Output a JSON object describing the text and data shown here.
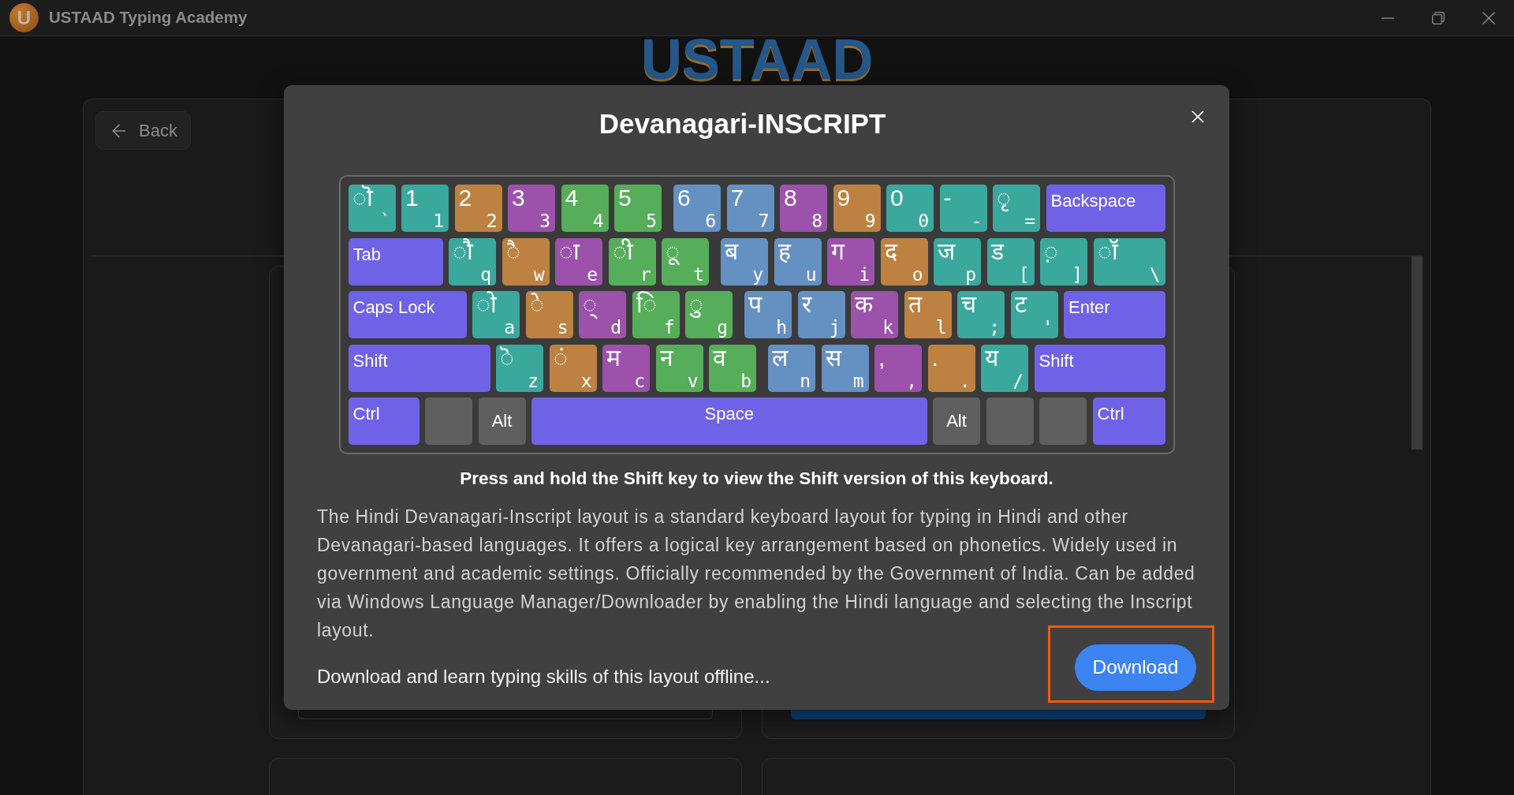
{
  "window": {
    "logo_letter": "U",
    "title": "USTAAD Typing Academy"
  },
  "brand_logo": "USTAAD",
  "back_button": "Back",
  "dialog": {
    "title": "Devanagari-INSCRIPT",
    "keyboard": {
      "rows": [
        {
          "keys": [
            {
              "kind": "char",
              "glyph": "◌ॊ",
              "key": "`",
              "color": "#3aa89d"
            },
            {
              "kind": "char",
              "glyph": "1",
              "key": "1",
              "color": "#3aa89d"
            },
            {
              "kind": "char",
              "glyph": "2",
              "key": "2",
              "color": "#bd8142"
            },
            {
              "kind": "char",
              "glyph": "3",
              "key": "3",
              "color": "#9c51aa"
            },
            {
              "kind": "char",
              "glyph": "4",
              "key": "4",
              "color": "#56ad5a"
            },
            {
              "kind": "char",
              "glyph": "5",
              "key": "5",
              "color": "#56ad5a"
            },
            {
              "kind": "char",
              "glyph": "6",
              "key": "6",
              "color": "#6590c2"
            },
            {
              "kind": "char",
              "glyph": "7",
              "key": "7",
              "color": "#6590c2"
            },
            {
              "kind": "char",
              "glyph": "8",
              "key": "8",
              "color": "#9c51aa"
            },
            {
              "kind": "char",
              "glyph": "9",
              "key": "9",
              "color": "#bd8142"
            },
            {
              "kind": "char",
              "glyph": "0",
              "key": "0",
              "color": "#3aa89d"
            },
            {
              "kind": "char",
              "glyph": "-",
              "key": "-",
              "color": "#3aa89d"
            },
            {
              "kind": "char",
              "glyph": "◌ृ",
              "key": "=",
              "color": "#3aa89d"
            },
            {
              "kind": "modifier",
              "label": "Backspace",
              "color": "#7062e6"
            }
          ]
        },
        {
          "keys": [
            {
              "kind": "modifier",
              "label": "Tab",
              "color": "#7062e6"
            },
            {
              "kind": "char",
              "glyph": "◌ौ",
              "key": "q",
              "color": "#3aa89d"
            },
            {
              "kind": "char",
              "glyph": "◌ै",
              "key": "w",
              "color": "#bd8142"
            },
            {
              "kind": "char",
              "glyph": "◌ा",
              "key": "e",
              "color": "#9c51aa"
            },
            {
              "kind": "char",
              "glyph": "◌ी",
              "key": "r",
              "color": "#56ad5a"
            },
            {
              "kind": "char",
              "glyph": "◌ू",
              "key": "t",
              "color": "#56ad5a"
            },
            {
              "kind": "char",
              "glyph": "ब",
              "key": "y",
              "color": "#6590c2"
            },
            {
              "kind": "char",
              "glyph": "ह",
              "key": "u",
              "color": "#6590c2"
            },
            {
              "kind": "char",
              "glyph": "ग",
              "key": "i",
              "color": "#9c51aa"
            },
            {
              "kind": "char",
              "glyph": "द",
              "key": "o",
              "color": "#bd8142"
            },
            {
              "kind": "char",
              "glyph": "ज",
              "key": "p",
              "color": "#3aa89d"
            },
            {
              "kind": "char",
              "glyph": "ड",
              "key": "[",
              "color": "#3aa89d"
            },
            {
              "kind": "char",
              "glyph": "◌़",
              "key": "]",
              "color": "#3aa89d"
            },
            {
              "kind": "char",
              "glyph": "◌ॉ",
              "key": "\\",
              "color": "#3aa89d"
            }
          ]
        },
        {
          "keys": [
            {
              "kind": "modifier",
              "label": "Caps Lock",
              "color": "#7062e6"
            },
            {
              "kind": "char",
              "glyph": "◌ो",
              "key": "a",
              "color": "#3aa89d"
            },
            {
              "kind": "char",
              "glyph": "◌े",
              "key": "s",
              "color": "#bd8142"
            },
            {
              "kind": "char",
              "glyph": "◌्",
              "key": "d",
              "color": "#9c51aa"
            },
            {
              "kind": "char",
              "glyph": "◌ि",
              "key": "f",
              "color": "#56ad5a"
            },
            {
              "kind": "char",
              "glyph": "◌ु",
              "key": "g",
              "color": "#56ad5a"
            },
            {
              "kind": "char",
              "glyph": "प",
              "key": "h",
              "color": "#6590c2"
            },
            {
              "kind": "char",
              "glyph": "र",
              "key": "j",
              "color": "#6590c2"
            },
            {
              "kind": "char",
              "glyph": "क",
              "key": "k",
              "color": "#9c51aa"
            },
            {
              "kind": "char",
              "glyph": "त",
              "key": "l",
              "color": "#bd8142"
            },
            {
              "kind": "char",
              "glyph": "च",
              "key": ";",
              "color": "#3aa89d"
            },
            {
              "kind": "char",
              "glyph": "ट",
              "key": "'",
              "color": "#3aa89d"
            },
            {
              "kind": "modifier",
              "label": "Enter",
              "color": "#7062e6"
            }
          ]
        },
        {
          "keys": [
            {
              "kind": "modifier",
              "label": "Shift",
              "color": "#7062e6"
            },
            {
              "kind": "char",
              "glyph": "◌ॆ",
              "key": "z",
              "color": "#3aa89d"
            },
            {
              "kind": "char",
              "glyph": "◌ं",
              "key": "x",
              "color": "#bd8142"
            },
            {
              "kind": "char",
              "glyph": "म",
              "key": "c",
              "color": "#9c51aa"
            },
            {
              "kind": "char",
              "glyph": "न",
              "key": "v",
              "color": "#56ad5a"
            },
            {
              "kind": "char",
              "glyph": "व",
              "key": "b",
              "color": "#56ad5a"
            },
            {
              "kind": "char",
              "glyph": "ल",
              "key": "n",
              "color": "#6590c2"
            },
            {
              "kind": "char",
              "glyph": "स",
              "key": "m",
              "color": "#6590c2"
            },
            {
              "kind": "char",
              "glyph": ",",
              "key": ",",
              "color": "#9c51aa"
            },
            {
              "kind": "char",
              "glyph": ".",
              "key": ".",
              "color": "#bd8142"
            },
            {
              "kind": "char",
              "glyph": "य",
              "key": "/",
              "color": "#3aa89d"
            },
            {
              "kind": "modifier",
              "label": "Shift",
              "color": "#7062e6"
            }
          ]
        },
        {
          "keys": [
            {
              "kind": "modifier",
              "label": "Ctrl",
              "color": "#7062e6"
            },
            {
              "kind": "blank",
              "color": "#5f5f5f"
            },
            {
              "kind": "center",
              "label": "Alt",
              "color": "#5f5f5f"
            },
            {
              "kind": "space",
              "label": "Space",
              "color": "#7062e6"
            },
            {
              "kind": "center",
              "label": "Alt",
              "color": "#5f5f5f"
            },
            {
              "kind": "blank",
              "color": "#5f5f5f"
            },
            {
              "kind": "blank",
              "color": "#5f5f5f"
            },
            {
              "kind": "modifier",
              "label": "Ctrl",
              "color": "#7062e6"
            }
          ]
        }
      ]
    },
    "shift_hint": "Press and hold the Shift key to view the Shift version of this keyboard.",
    "description": "The Hindi Devanagari-Inscript layout is a standard keyboard layout for typing in Hindi and other Devanagari-based languages. It offers a logical key arrangement based on phonetics. Widely used in government and academic settings. Officially recommended by the Government of India. Can be added via Windows Language Manager/Downloader by enabling the Hindi language and selecting the Inscript layout.",
    "offline_note": "Download and learn typing skills of this layout offline...",
    "download_button": "Download"
  }
}
